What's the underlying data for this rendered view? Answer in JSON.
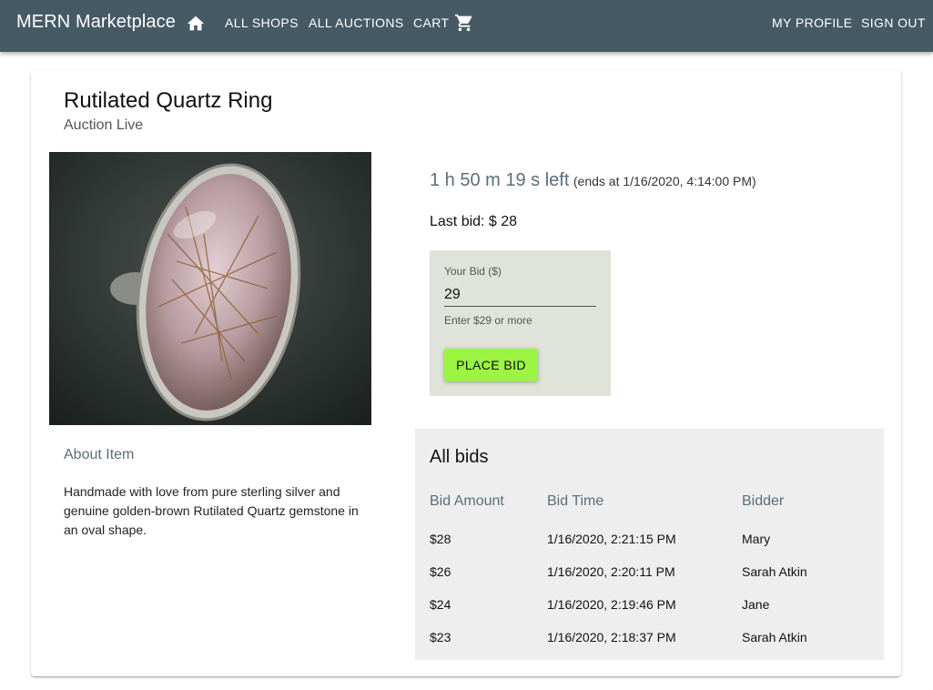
{
  "appbar": {
    "brand": "MERN Marketplace",
    "nav": {
      "all_shops": "ALL SHOPS",
      "all_auctions": "ALL AUCTIONS",
      "cart": "CART"
    },
    "right": {
      "my_profile": "MY PROFILE",
      "sign_out": "SIGN OUT"
    },
    "icons": {
      "home": "home-icon",
      "cart": "cart-icon"
    },
    "color": "#455a64"
  },
  "auction": {
    "title": "Rutilated Quartz Ring",
    "status": "Auction Live",
    "countdown": "1 h 50 m 19 s left",
    "ends_at": "(ends at 1/16/2020, 4:14:00 PM)",
    "last_bid": "Last bid: $ 28",
    "about_heading": "About Item",
    "description": "Handmade with love from pure sterling silver and genuine golden-brown Rutilated Quartz gemstone in an oval shape."
  },
  "bid_form": {
    "label": "Your Bid ($)",
    "value": "29",
    "helper": "Enter $29 or more",
    "button": "PLACE BID",
    "button_color": "#9bf542",
    "box_color": "#dfe3d9"
  },
  "bids": {
    "title": "All bids",
    "columns": [
      "Bid Amount",
      "Bid Time",
      "Bidder"
    ],
    "rows": [
      [
        "$28",
        "1/16/2020, 2:21:15 PM",
        "Mary"
      ],
      [
        "$26",
        "1/16/2020, 2:20:11 PM",
        "Sarah Atkin"
      ],
      [
        "$24",
        "1/16/2020, 2:19:46 PM",
        "Jane"
      ],
      [
        "$23",
        "1/16/2020, 2:18:37 PM",
        "Sarah Atkin"
      ]
    ]
  }
}
